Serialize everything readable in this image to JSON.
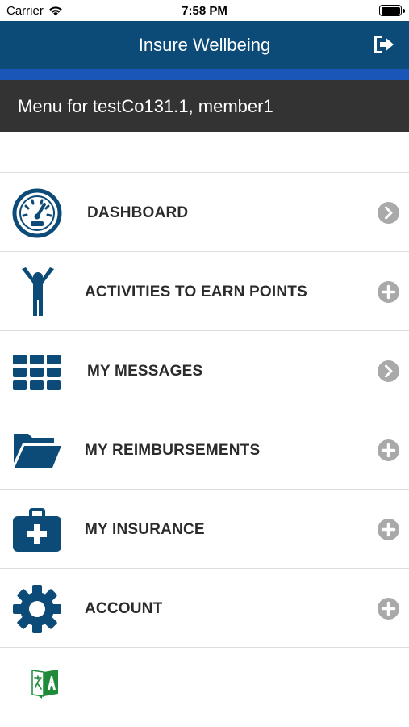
{
  "status_bar": {
    "carrier": "Carrier",
    "time": "7:58 PM",
    "icons": [
      "wifi-icon",
      "battery-icon"
    ]
  },
  "nav_bar": {
    "title": "Insure Wellbeing",
    "logout_icon": "logout-icon"
  },
  "menu_header": {
    "text": "Menu for testCo131.1, member1"
  },
  "menu": {
    "items": [
      {
        "label": "DASHBOARD",
        "icon": "dashboard-gauge-icon",
        "action_icon": "chevron-right-icon"
      },
      {
        "label": "ACTIVITIES TO EARN POINTS",
        "icon": "person-activity-icon",
        "action_icon": "plus-circle-icon"
      },
      {
        "label": "MY MESSAGES",
        "icon": "grid-icon",
        "action_icon": "chevron-right-icon"
      },
      {
        "label": "MY REIMBURSEMENTS",
        "icon": "folder-icon",
        "action_icon": "plus-circle-icon"
      },
      {
        "label": "MY INSURANCE",
        "icon": "medical-kit-icon",
        "action_icon": "plus-circle-icon"
      },
      {
        "label": "ACCOUNT",
        "icon": "gear-icon",
        "action_icon": "plus-circle-icon"
      }
    ]
  },
  "footer": {
    "language_icon": "translate-icon"
  },
  "colors": {
    "nav_background": "#0c4a78",
    "accent_strip": "#1a56b8",
    "menu_header_background": "#333333",
    "icon_color": "#0c4a78",
    "action_icon_color": "#a9a9a9",
    "translate_green": "#1f8a3a"
  }
}
